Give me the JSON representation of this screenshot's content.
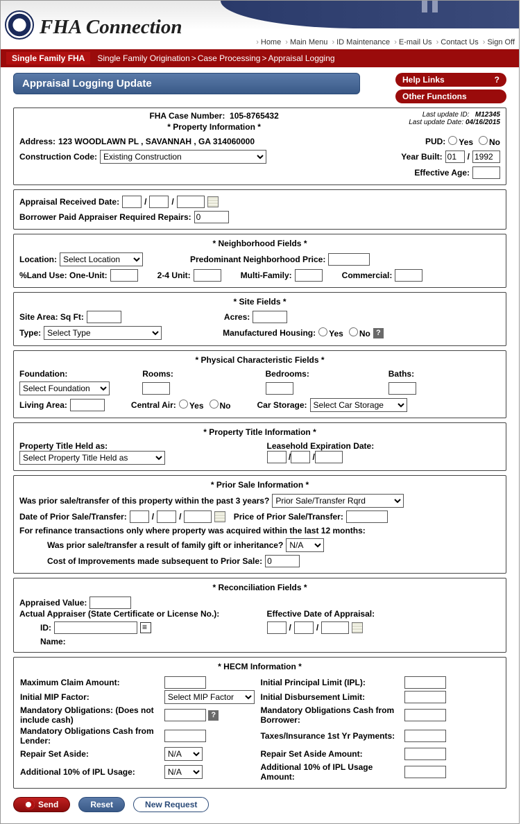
{
  "app": {
    "title": "FHA Connection"
  },
  "top_nav": [
    "Home",
    "Main Menu",
    "ID Maintenance",
    "E-mail Us",
    "Contact Us",
    "Sign Off"
  ],
  "red_bar": {
    "first": "Single Family FHA",
    "path": [
      "Single Family Origination",
      "Case Processing",
      "Appraisal Logging"
    ]
  },
  "panel_title": "Appraisal Logging Update",
  "help_links": "Help Links",
  "other_functions": "Other Functions",
  "meta": {
    "last_update_id_label": "Last update ID:",
    "last_update_id": "M12345",
    "last_update_date_label": "Last update Date:",
    "last_update_date": "04/16/2015"
  },
  "property_info": {
    "header": "* Property Information *",
    "case_label": "FHA Case Number:",
    "case_number": "105-8765432",
    "address_label": "Address:",
    "address": "123 WOODLAWN PL , SAVANNAH , GA 314060000",
    "pud_label": "PUD:",
    "yes": "Yes",
    "no": "No",
    "construction_label": "Construction Code:",
    "construction_value": "Existing Construction",
    "year_built_label": "Year Built:",
    "year_built_mm": "01",
    "year_built_yyyy": "1992",
    "effective_age_label": "Effective Age:"
  },
  "appraisal": {
    "received_label": "Appraisal Received Date:",
    "borrower_repairs_label": "Borrower Paid Appraiser Required Repairs:",
    "borrower_repairs_value": "0"
  },
  "neighborhood": {
    "header": "* Neighborhood Fields *",
    "location_label": "Location:",
    "location_value": "Select Location",
    "predominant_label": "Predominant Neighborhood Price:",
    "land_use_label": "%Land Use: One-Unit:",
    "two4_label": "2-4 Unit:",
    "multi_label": "Multi-Family:",
    "commercial_label": "Commercial:"
  },
  "site": {
    "header": "* Site Fields *",
    "area_label": "Site Area: Sq Ft:",
    "acres_label": "Acres:",
    "type_label": "Type:",
    "type_value": "Select Type",
    "mfg_label": "Manufactured Housing:",
    "yes": "Yes",
    "no": "No"
  },
  "physical": {
    "header": "* Physical Characteristic Fields *",
    "foundation_label": "Foundation:",
    "foundation_value": "Select Foundation",
    "rooms_label": "Rooms:",
    "bedrooms_label": "Bedrooms:",
    "baths_label": "Baths:",
    "living_area_label": "Living Area:",
    "central_air_label": "Central Air:",
    "yes": "Yes",
    "no": "No",
    "car_storage_label": "Car Storage:",
    "car_storage_value": "Select Car Storage"
  },
  "title": {
    "header": "* Property Title Information *",
    "held_as_label": "Property Title Held as:",
    "held_as_value": "Select Property Title Held as",
    "leasehold_label": "Leasehold Expiration Date:"
  },
  "prior_sale": {
    "header": "* Prior Sale Information *",
    "q3yr": "Was prior sale/transfer of this property within the past 3 years?",
    "q3yr_value": "Prior Sale/Transfer Rqrd",
    "date_label": "Date of Prior Sale/Transfer:",
    "price_label": "Price of Prior Sale/Transfer:",
    "refi_note": "For refinance transactions only where property was acquired within the last 12 months:",
    "gift_label": "Was prior sale/transfer a result of family gift or inheritance?",
    "gift_value": "N/A",
    "improvements_label": "Cost of Improvements made subsequent to Prior Sale:",
    "improvements_value": "0"
  },
  "reconciliation": {
    "header": "* Reconciliation Fields *",
    "appraised_label": "Appraised Value:",
    "actual_label": "Actual Appraiser (State Certificate or License No.):",
    "effective_date_label": "Effective Date of Appraisal:",
    "id_label": "ID:",
    "name_label": "Name:"
  },
  "hecm": {
    "header": "* HECM Information *",
    "max_claim_label": "Maximum Claim Amount:",
    "ipl_label": "Initial Principal Limit (IPL):",
    "mip_label": "Initial MIP Factor:",
    "mip_value": "Select MIP Factor",
    "idl_label": "Initial Disbursement Limit:",
    "mandatory_label": "Mandatory Obligations: (Does not include cash)",
    "mandatory_cash_borrower_label": "Mandatory Obligations Cash from Borrower:",
    "mandatory_cash_lender_label": "Mandatory Obligations Cash from Lender:",
    "taxes_label": "Taxes/Insurance 1st Yr Payments:",
    "repair_set_aside_label": "Repair Set Aside:",
    "repair_set_aside_value": "N/A",
    "repair_set_aside_amount_label": "Repair Set Aside Amount:",
    "additional_ipl_label": "Additional 10% of IPL Usage:",
    "additional_ipl_value": "N/A",
    "additional_ipl_amount_label": "Additional 10% of IPL Usage Amount:"
  },
  "buttons": {
    "send": "Send",
    "reset": "Reset",
    "new_request": "New Request"
  }
}
